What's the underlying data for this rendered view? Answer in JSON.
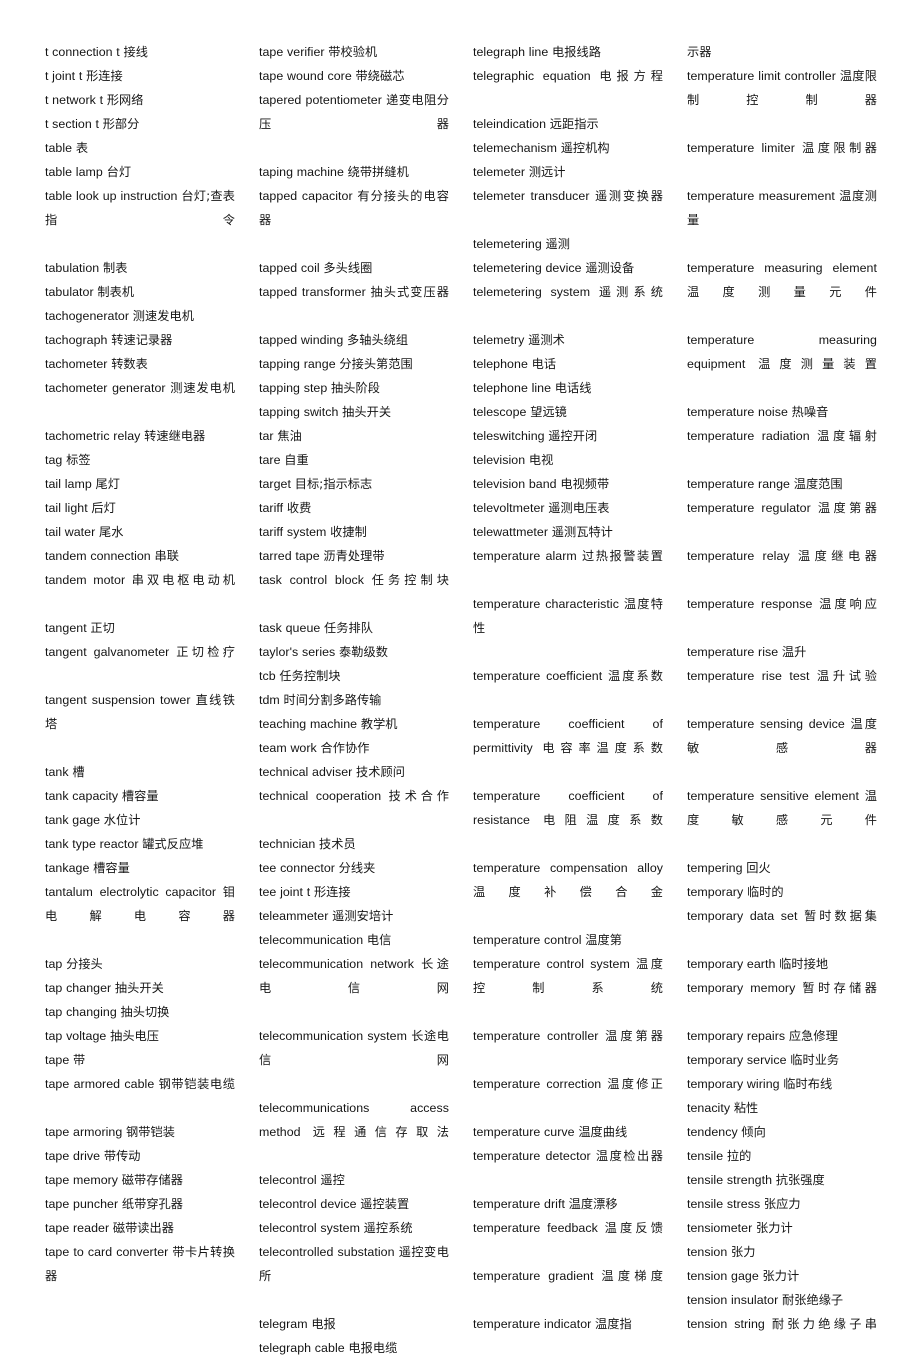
{
  "page": {
    "kind": "scanned-dictionary-page",
    "language_pair": "English-Chinese",
    "subject": "electrical / technical terms",
    "columns_count": 4,
    "background_color": "#ffffff",
    "text_color": "#141414"
  },
  "columns": [
    {
      "index": 1,
      "entries": [
        {
          "en": "t connection t",
          "cn": "接线",
          "justified": false
        },
        {
          "en": "t joint t",
          "cn": "形连接",
          "justified": false
        },
        {
          "en": "t network t",
          "cn": "形网络",
          "justified": false
        },
        {
          "en": "t section t",
          "cn": "形部分",
          "justified": false
        },
        {
          "en": "table",
          "cn": "表",
          "justified": false
        },
        {
          "en": "table lamp",
          "cn": "台灯",
          "justified": false
        },
        {
          "en": "table look up instruction",
          "cn": "台灯;查表指令",
          "justified": true
        },
        {
          "en": "tabulation",
          "cn": "制表",
          "justified": false
        },
        {
          "en": "tabulator",
          "cn": "制表机",
          "justified": false
        },
        {
          "en": "tachogenerator",
          "cn": "测速发电机",
          "justified": false
        },
        {
          "en": "tachograph",
          "cn": "转速记录器",
          "justified": false
        },
        {
          "en": "tachometer",
          "cn": "转数表",
          "justified": false
        },
        {
          "en": "tachometer generator",
          "cn": "测速发电机",
          "justified": true
        },
        {
          "en": "tachometric relay",
          "cn": "转速继电器",
          "justified": false
        },
        {
          "en": "tag",
          "cn": "标签",
          "justified": false
        },
        {
          "en": "tail lamp",
          "cn": "尾灯",
          "justified": false
        },
        {
          "en": "tail light",
          "cn": "后灯",
          "justified": false
        },
        {
          "en": "tail water",
          "cn": "尾水",
          "justified": false
        },
        {
          "en": "tandem connection",
          "cn": "串联",
          "justified": false
        },
        {
          "en": "tandem motor",
          "cn": "串双电枢电动机",
          "justified": true
        },
        {
          "en": "tangent",
          "cn": "正切",
          "justified": false
        },
        {
          "en": "tangent galvanometer",
          "cn": "正切检疗",
          "justified": true
        },
        {
          "en": "tangent suspension tower",
          "cn": "直线铁塔",
          "justified": true
        },
        {
          "en": "tank",
          "cn": "槽",
          "justified": false
        },
        {
          "en": "tank capacity",
          "cn": "槽容量",
          "justified": false
        },
        {
          "en": "tank gage",
          "cn": "水位计",
          "justified": false
        },
        {
          "en": "tank type reactor",
          "cn": "罐式反应堆",
          "justified": false
        },
        {
          "en": "tankage",
          "cn": "槽容量",
          "justified": false
        },
        {
          "en": "tantalum electrolytic capacitor",
          "cn": "钼电解电容器",
          "justified": true
        },
        {
          "en": "tap",
          "cn": "分接头",
          "justified": false
        },
        {
          "en": "tap changer",
          "cn": "抽头开关",
          "justified": false
        },
        {
          "en": "tap changing",
          "cn": "抽头切换",
          "justified": false
        },
        {
          "en": "tap voltage",
          "cn": "抽头电压",
          "justified": false
        },
        {
          "en": "tape",
          "cn": "带",
          "justified": false
        },
        {
          "en": "tape armored cable",
          "cn": "钢带铠装电缆",
          "justified": true
        },
        {
          "en": "tape armoring",
          "cn": "钢带铠装",
          "justified": false
        },
        {
          "en": "tape drive",
          "cn": "带传动",
          "justified": false
        },
        {
          "en": "tape memory",
          "cn": "磁带存储器",
          "justified": false
        },
        {
          "en": "tape puncher",
          "cn": "纸带穿孔器",
          "justified": false
        },
        {
          "en": "tape reader",
          "cn": "磁带读出器",
          "justified": false
        },
        {
          "en": "tape to card converter",
          "cn": "带卡片转换器",
          "justified": true
        }
      ]
    },
    {
      "index": 2,
      "entries": [
        {
          "en": "tape verifier",
          "cn": "带校验机",
          "justified": false
        },
        {
          "en": "tape wound core",
          "cn": "带绕磁芯",
          "justified": false
        },
        {
          "en": "tapered potentiometer",
          "cn": "递变电阻分压器",
          "justified": true
        },
        {
          "en": "taping machine",
          "cn": "绕带拼缝机",
          "justified": false
        },
        {
          "en": "tapped capacitor",
          "cn": "有分接头的电容器",
          "justified": true
        },
        {
          "en": "tapped coil",
          "cn": "多头线圈",
          "justified": false
        },
        {
          "en": "tapped transformer",
          "cn": "抽头式变压器",
          "justified": true
        },
        {
          "en": "tapped winding",
          "cn": "多轴头绕组",
          "justified": false
        },
        {
          "en": "tapping range",
          "cn": "分接头第范围",
          "justified": false
        },
        {
          "en": "tapping step",
          "cn": "抽头阶段",
          "justified": false
        },
        {
          "en": "tapping switch",
          "cn": "抽头开关",
          "justified": false
        },
        {
          "en": "tar",
          "cn": "焦油",
          "justified": false
        },
        {
          "en": "tare",
          "cn": "自重",
          "justified": false
        },
        {
          "en": "target",
          "cn": "目标;指示标志",
          "justified": false
        },
        {
          "en": "tariff",
          "cn": "收费",
          "justified": false
        },
        {
          "en": "tariff system",
          "cn": "收捷制",
          "justified": false
        },
        {
          "en": "tarred tape",
          "cn": "沥青处理带",
          "justified": false
        },
        {
          "en": "task control block",
          "cn": "任务控制块",
          "justified": true
        },
        {
          "en": "task queue",
          "cn": "任务排队",
          "justified": false
        },
        {
          "en": "taylor's series",
          "cn": "泰勒级数",
          "justified": false
        },
        {
          "en": "tcb",
          "cn": "任务控制块",
          "justified": false
        },
        {
          "en": "tdm",
          "cn": "时间分割多路传输",
          "justified": false
        },
        {
          "en": "teaching machine",
          "cn": "教学机",
          "justified": false
        },
        {
          "en": "team work",
          "cn": "合作协作",
          "justified": false
        },
        {
          "en": "technical adviser",
          "cn": "技术顾问",
          "justified": false
        },
        {
          "en": "technical cooperation",
          "cn": "技术合作",
          "justified": true
        },
        {
          "en": "technician",
          "cn": "技术员",
          "justified": false
        },
        {
          "en": "tee connector",
          "cn": "分线夹",
          "justified": false
        },
        {
          "en": "tee joint t",
          "cn": "形连接",
          "justified": false
        },
        {
          "en": "teleammeter",
          "cn": "遥测安培计",
          "justified": false
        },
        {
          "en": "telecommunication",
          "cn": "电信",
          "justified": false
        },
        {
          "en": "telecommunication network",
          "cn": "长途电信网",
          "justified": true
        },
        {
          "en": "telecommunication system",
          "cn": "长途电信网",
          "justified": true
        },
        {
          "en": "telecommunications access method",
          "cn": "远程通信存取法",
          "justified": true
        },
        {
          "en": "telecontrol",
          "cn": "遥控",
          "justified": false
        },
        {
          "en": "telecontrol device",
          "cn": "遥控装置",
          "justified": false
        },
        {
          "en": "telecontrol system",
          "cn": "遥控系统",
          "justified": false
        },
        {
          "en": "telecontrolled substation",
          "cn": "遥控变电所",
          "justified": true
        },
        {
          "en": "telegram",
          "cn": "电报",
          "justified": false
        },
        {
          "en": "telegraph cable",
          "cn": "电报电缆",
          "justified": false
        }
      ]
    },
    {
      "index": 3,
      "entries": [
        {
          "en": "telegraph line",
          "cn": "电报线路",
          "justified": false
        },
        {
          "en": "telegraphic equation",
          "cn": "电报方程",
          "justified": true
        },
        {
          "en": "teleindication",
          "cn": "远距指示",
          "justified": false
        },
        {
          "en": "telemechanism",
          "cn": "遥控机构",
          "justified": false
        },
        {
          "en": "telemeter",
          "cn": "测远计",
          "justified": false
        },
        {
          "en": "telemeter transducer",
          "cn": "遥测变换器",
          "justified": true
        },
        {
          "en": "telemetering",
          "cn": "遥测",
          "justified": false
        },
        {
          "en": "telemetering device",
          "cn": "遥测设备",
          "justified": false
        },
        {
          "en": "telemetering system",
          "cn": "遥测系统",
          "justified": true
        },
        {
          "en": "telemetry",
          "cn": "遥测术",
          "justified": false
        },
        {
          "en": "telephone",
          "cn": "电话",
          "justified": false
        },
        {
          "en": "telephone line",
          "cn": "电话线",
          "justified": false
        },
        {
          "en": "telescope",
          "cn": "望远镜",
          "justified": false
        },
        {
          "en": "teleswitching",
          "cn": "遥控开闭",
          "justified": false
        },
        {
          "en": "television",
          "cn": "电视",
          "justified": false
        },
        {
          "en": "television band",
          "cn": "电视频带",
          "justified": false
        },
        {
          "en": "televoltmeter",
          "cn": "遥测电压表",
          "justified": false
        },
        {
          "en": "telewattmeter",
          "cn": "遥测瓦特计",
          "justified": false
        },
        {
          "en": "temperature alarm",
          "cn": "过热报警装置",
          "justified": true
        },
        {
          "en": "temperature characteristic",
          "cn": "温度特性",
          "justified": true
        },
        {
          "en": "temperature coefficient",
          "cn": "温度系数",
          "justified": true
        },
        {
          "en": "temperature coefficient of permittivity",
          "cn": "电容率温度系数",
          "justified": true
        },
        {
          "en": "temperature coefficient of resistance",
          "cn": "电阻温度系数",
          "justified": true
        },
        {
          "en": "temperature compensation alloy",
          "cn": "温度补偿合金",
          "justified": true
        },
        {
          "en": "temperature control",
          "cn": "温度第",
          "justified": false
        },
        {
          "en": "temperature control system",
          "cn": "温度控制系统",
          "justified": true
        },
        {
          "en": "temperature controller",
          "cn": "温度第器",
          "justified": true
        },
        {
          "en": "temperature correction",
          "cn": "温度修正",
          "justified": true
        },
        {
          "en": "temperature curve",
          "cn": "温度曲线",
          "justified": false
        },
        {
          "en": "temperature detector",
          "cn": "温度检出器",
          "justified": true
        },
        {
          "en": "temperature drift",
          "cn": "温度漂移",
          "justified": false
        },
        {
          "en": "temperature feedback",
          "cn": "温度反馈",
          "justified": true
        },
        {
          "en": "temperature gradient",
          "cn": "温度梯度",
          "justified": true
        },
        {
          "en": "temperature indicator",
          "cn": "温度指",
          "justified": false
        }
      ]
    },
    {
      "index": 4,
      "entries": [
        {
          "en": "",
          "cn": "示器",
          "justified": false,
          "fragment": true
        },
        {
          "en": "temperature limit controller",
          "cn": "温度限制控制器",
          "justified": true
        },
        {
          "en": "temperature limiter",
          "cn": "温度限制器",
          "justified": true
        },
        {
          "en": "temperature measurement",
          "cn": "温度测量",
          "justified": true
        },
        {
          "en": "temperature measuring element",
          "cn": "温度测量元件",
          "justified": true
        },
        {
          "en": "temperature measuring equipment",
          "cn": "温度测量装置",
          "justified": true
        },
        {
          "en": "temperature noise",
          "cn": "热噪音",
          "justified": false
        },
        {
          "en": "temperature radiation",
          "cn": "温度辐射",
          "justified": true
        },
        {
          "en": "temperature range",
          "cn": "温度范围",
          "justified": false
        },
        {
          "en": "temperature regulator",
          "cn": "温度第器",
          "justified": true
        },
        {
          "en": "temperature relay",
          "cn": "温度继电器",
          "justified": true
        },
        {
          "en": "temperature response",
          "cn": "温度响应",
          "justified": true
        },
        {
          "en": "temperature rise",
          "cn": "温升",
          "justified": false
        },
        {
          "en": "temperature rise test",
          "cn": "温升试验",
          "justified": true
        },
        {
          "en": "temperature sensing device",
          "cn": "温度敏感器",
          "justified": true
        },
        {
          "en": "temperature sensitive element",
          "cn": "温度敏感元件",
          "justified": true
        },
        {
          "en": "tempering",
          "cn": "回火",
          "justified": false
        },
        {
          "en": "temporary",
          "cn": "临时的",
          "justified": false
        },
        {
          "en": "temporary data set",
          "cn": "暂时数据集",
          "justified": true
        },
        {
          "en": "temporary earth",
          "cn": "临时接地",
          "justified": false
        },
        {
          "en": "temporary memory",
          "cn": "暂时存储器",
          "justified": true
        },
        {
          "en": "temporary repairs",
          "cn": "应急修理",
          "justified": false
        },
        {
          "en": "temporary service",
          "cn": "临时业务",
          "justified": false
        },
        {
          "en": "temporary wiring",
          "cn": "临时布线",
          "justified": false
        },
        {
          "en": "tenacity",
          "cn": "粘性",
          "justified": false
        },
        {
          "en": "tendency",
          "cn": "倾向",
          "justified": false
        },
        {
          "en": "tensile",
          "cn": "拉的",
          "justified": false
        },
        {
          "en": "tensile strength",
          "cn": "抗张强度",
          "justified": false
        },
        {
          "en": "tensile stress",
          "cn": "张应力",
          "justified": false
        },
        {
          "en": "tensiometer",
          "cn": "张力计",
          "justified": false
        },
        {
          "en": "tension",
          "cn": "张力",
          "justified": false
        },
        {
          "en": "tension gage",
          "cn": "张力计",
          "justified": false
        },
        {
          "en": "tension insulator",
          "cn": "耐张绝缘子",
          "justified": false
        },
        {
          "en": "tension string",
          "cn": "耐张力绝缘子串",
          "justified": true
        }
      ]
    }
  ]
}
